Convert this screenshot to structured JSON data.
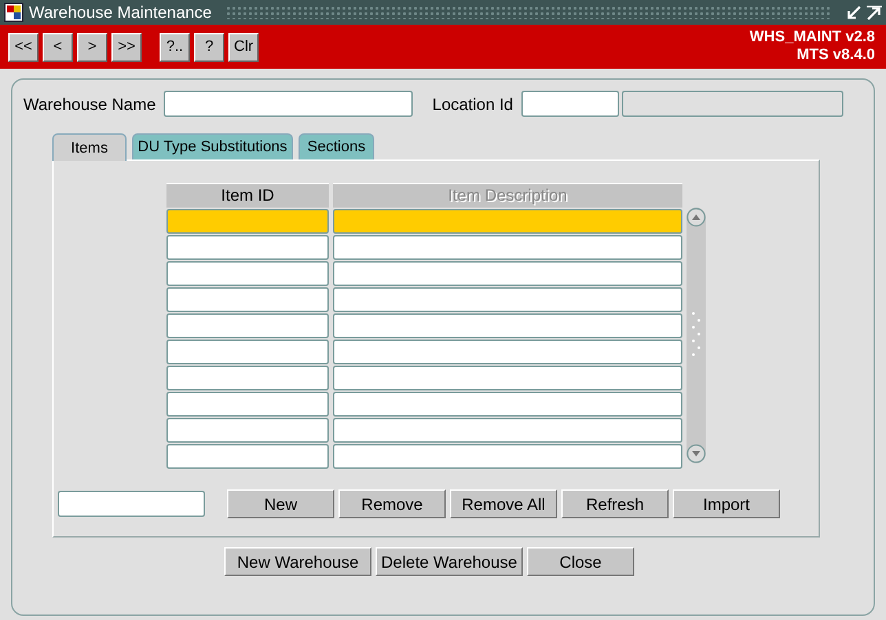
{
  "window": {
    "title": "Warehouse Maintenance"
  },
  "toolbar": {
    "buttons": [
      "<<",
      "<",
      ">",
      ">>",
      "?..",
      "?",
      "Clr"
    ],
    "version_lines": [
      "WHS_MAINT v2.8",
      "MTS v8.4.0"
    ]
  },
  "header_fields": [
    {
      "label": "Warehouse Name",
      "kind": "text",
      "disabled": false
    },
    {
      "label": "Location Id",
      "kind": "text",
      "disabled": false
    },
    {
      "kind": "text",
      "disabled": true
    }
  ],
  "tabs": [
    {
      "label": "Items",
      "selected": true
    },
    {
      "label": "DU Type Substitutions",
      "selected": false
    },
    {
      "label": "Sections",
      "selected": false
    }
  ],
  "table": {
    "columns": [
      {
        "label": "Item ID",
        "disabled": false
      },
      {
        "label": "Item Description",
        "disabled": true
      }
    ],
    "rows": [
      {
        "selected": true
      },
      {
        "selected": false
      },
      {
        "selected": false
      },
      {
        "selected": false
      },
      {
        "selected": false
      },
      {
        "selected": false
      },
      {
        "selected": false
      },
      {
        "selected": false
      },
      {
        "selected": false
      },
      {
        "selected": false
      }
    ]
  },
  "item_actions": [
    "New",
    "Remove",
    "Remove All",
    "Refresh",
    "Import"
  ],
  "buttons": [
    "New Warehouse",
    "Delete Warehouse",
    "Close"
  ]
}
